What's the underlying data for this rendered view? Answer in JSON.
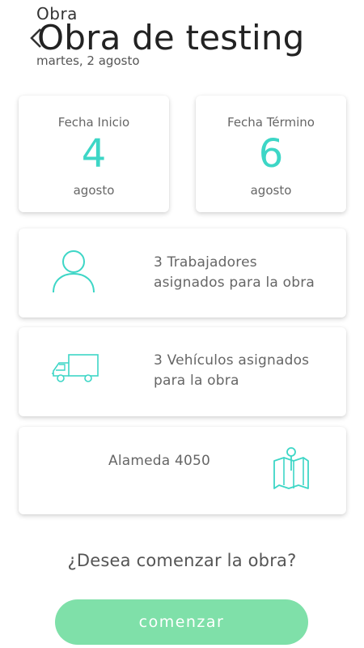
{
  "header": {
    "label": "Obra",
    "title": "Obra de testing",
    "date": "martes, 2 agosto"
  },
  "dates": {
    "start": {
      "label": "Fecha Inicio",
      "day": "4",
      "month": "agosto"
    },
    "end": {
      "label": "Fecha Término",
      "day": "6",
      "month": "agosto"
    }
  },
  "workers": {
    "icon": "person-icon",
    "text": "3 Trabajadores asignados para la obra"
  },
  "vehicles": {
    "icon": "truck-icon",
    "text": "3 Vehículos asignados para la obra"
  },
  "address": {
    "icon": "map-icon",
    "text": "Alameda 4050"
  },
  "question": "¿Desea comenzar la obra?",
  "start_button": "comenzar",
  "colors": {
    "accent": "#3dd6c6",
    "button": "#7fe0a9"
  }
}
